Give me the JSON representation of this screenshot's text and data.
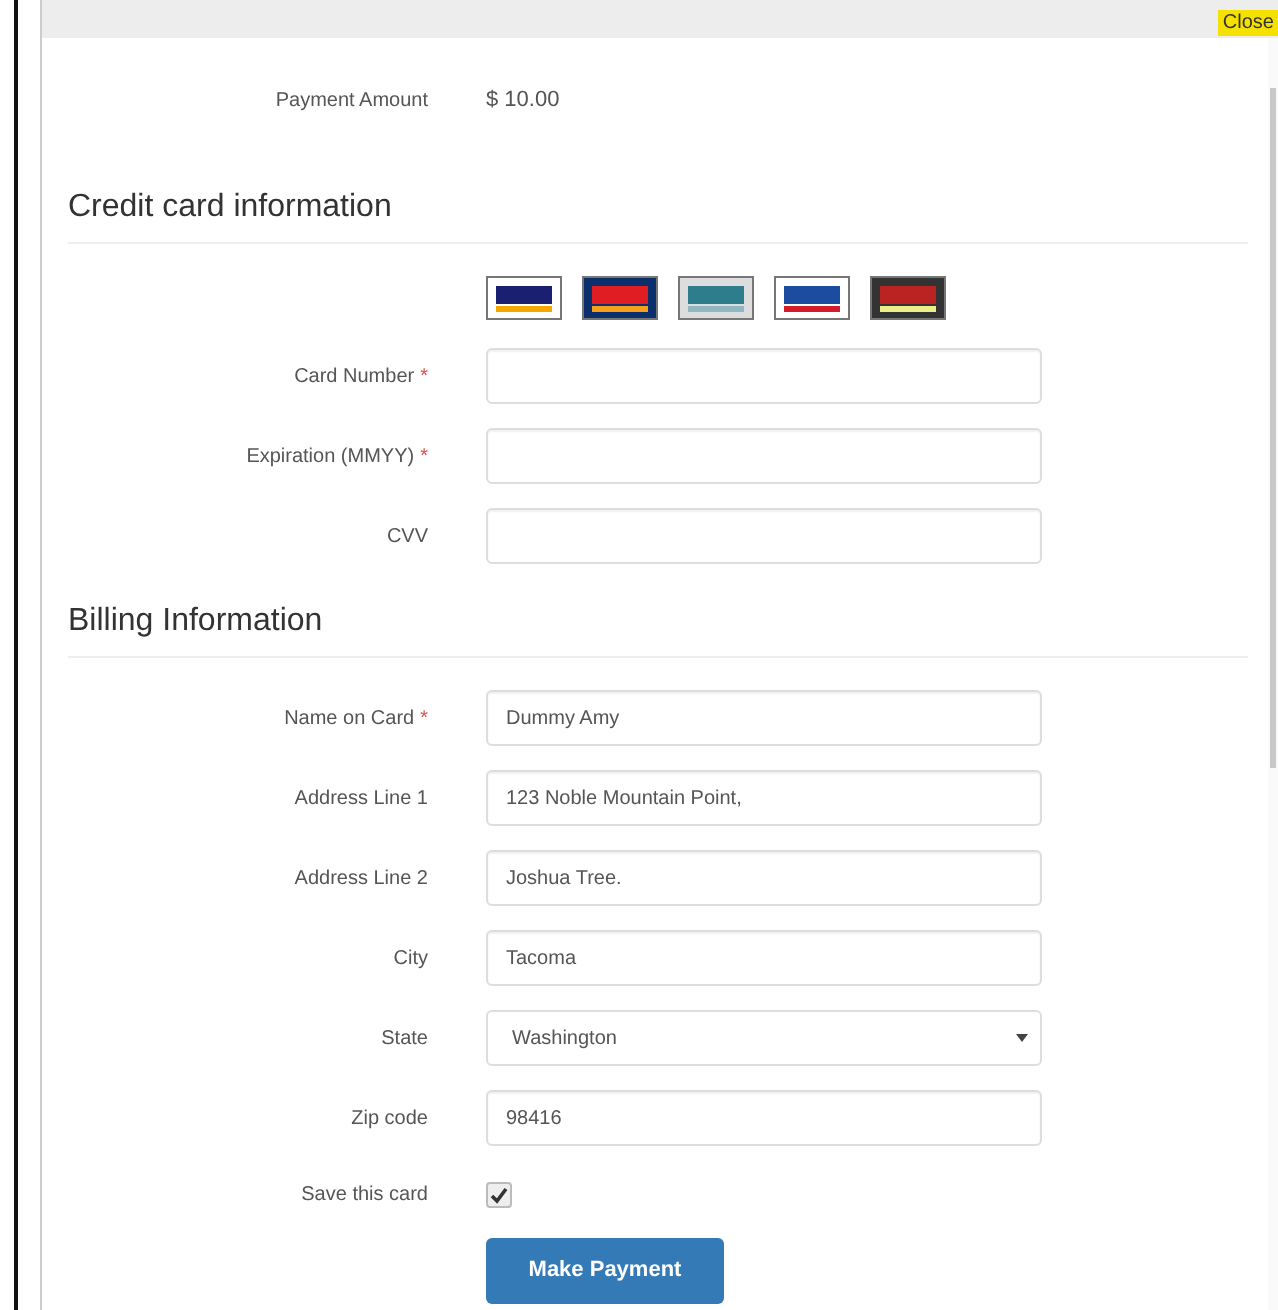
{
  "close_button": {
    "label": "Close"
  },
  "payment_amount": {
    "label": "Payment Amount",
    "value": "$ 10.00"
  },
  "sections": [
    {
      "title": "Credit card information",
      "card_logos": true,
      "fields": [
        {
          "kind": "text",
          "label": "Card Number",
          "required_mark": "*"
        },
        {
          "kind": "text",
          "label": "Expiration (MMYY)",
          "required_mark": "*"
        },
        {
          "kind": "text",
          "label": "CVV"
        }
      ]
    },
    {
      "title": "Billing Information",
      "fields": [
        {
          "kind": "text",
          "label": "Name on Card",
          "required_mark": "*",
          "value": "Dummy Amy"
        },
        {
          "kind": "text",
          "label": "Address Line 1",
          "value": "123 Noble Mountain Point,"
        },
        {
          "kind": "text",
          "label": "Address Line 2",
          "value": "Joshua Tree."
        },
        {
          "kind": "text",
          "label": "City",
          "value": "Tacoma"
        },
        {
          "kind": "select",
          "label": "State",
          "value": "Washington"
        },
        {
          "kind": "text",
          "label": "Zip code",
          "value": "98416"
        },
        {
          "kind": "checkbox",
          "label": "Save this card",
          "checked": true
        }
      ]
    }
  ],
  "submit_button": {
    "label": "Make Payment"
  }
}
